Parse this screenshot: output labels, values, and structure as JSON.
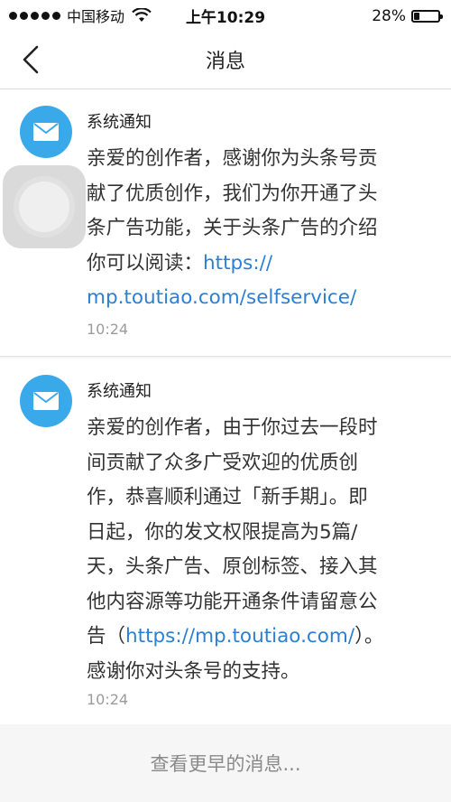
{
  "status_bar": {
    "carrier": "中国移动",
    "time": "上午10:29",
    "battery_percent": "28%",
    "battery_level": 0.28
  },
  "nav": {
    "title": "消息",
    "back_icon": "chevron-left-icon"
  },
  "messages": [
    {
      "sender": "系统通知",
      "lines": [
        "亲爱的创作者，感谢你为头条号贡",
        "献了优质创作，我们为你开通了头",
        "条广告功能，关于头条广告的介绍",
        "你可以阅读："
      ],
      "link_line1": "https://",
      "link_line2": "mp.toutiao.com/selfservice/",
      "time": "10:24",
      "icon": "mail-icon"
    },
    {
      "sender": "系统通知",
      "lines": [
        "亲爱的创作者，由于你过去一段时",
        "间贡献了众多广受欢迎的优质创",
        "作，恭喜顺利通过「新手期」。即",
        "日起，你的发文权限提高为5篇/",
        "天，头条广告、原创标签、接入其",
        "他内容源等功能开通条件请留意公"
      ],
      "line7_prefix": "告（",
      "link": "https://mp.toutiao.com/",
      "line7_suffix": "）。",
      "line8": "感谢你对头条号的支持。",
      "time": "10:24",
      "icon": "mail-icon"
    }
  ],
  "footer": {
    "load_more": "查看更早的消息..."
  },
  "colors": {
    "avatar": "#3aa9ea",
    "link": "#2b7fd4",
    "background": "#f6f6f6"
  }
}
